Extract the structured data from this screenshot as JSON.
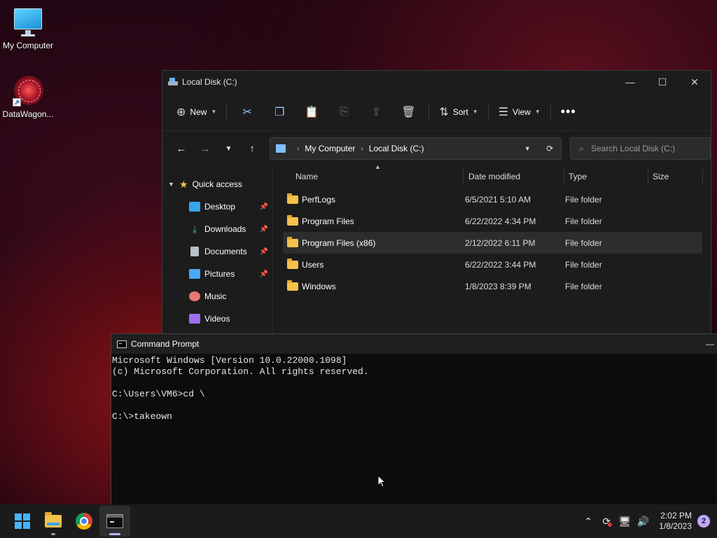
{
  "desktop": {
    "icons": [
      {
        "label": "My Computer",
        "icon": "monitor-icon"
      },
      {
        "label": "DataWagon...",
        "icon": "datawagon-icon"
      }
    ]
  },
  "explorer": {
    "title": "Local Disk (C:)",
    "toolbar": {
      "new_label": "New",
      "sort_label": "Sort",
      "view_label": "View",
      "icons": [
        "cut-icon",
        "copy-icon",
        "paste-icon",
        "rename-icon",
        "share-icon",
        "delete-icon",
        "more-icon"
      ]
    },
    "breadcrumb": [
      "My Computer",
      "Local Disk (C:)"
    ],
    "search_placeholder": "Search Local Disk (C:)",
    "nav": {
      "quick_access": "Quick access",
      "items": [
        {
          "label": "Desktop",
          "pinned": true,
          "icon": "desktop-icon",
          "color": "#3aa6f0"
        },
        {
          "label": "Downloads",
          "pinned": true,
          "icon": "download-icon",
          "color": "#3ec46d"
        },
        {
          "label": "Documents",
          "pinned": true,
          "icon": "documents-icon",
          "color": "#b7c0cc"
        },
        {
          "label": "Pictures",
          "pinned": true,
          "icon": "pictures-icon",
          "color": "#4aa8f5"
        },
        {
          "label": "Music",
          "pinned": false,
          "icon": "music-icon",
          "color": "#e8776f"
        },
        {
          "label": "Videos",
          "pinned": false,
          "icon": "videos-icon",
          "color": "#9b6ff0"
        }
      ]
    },
    "columns": {
      "name": "Name",
      "date": "Date modified",
      "type": "Type",
      "size": "Size"
    },
    "files": [
      {
        "name": "PerfLogs",
        "date": "6/5/2021 5:10 AM",
        "type": "File folder"
      },
      {
        "name": "Program Files",
        "date": "6/22/2022 4:34 PM",
        "type": "File folder"
      },
      {
        "name": "Program Files (x86)",
        "date": "2/12/2022 6:11 PM",
        "type": "File folder"
      },
      {
        "name": "Users",
        "date": "6/22/2022 3:44 PM",
        "type": "File folder"
      },
      {
        "name": "Windows",
        "date": "1/8/2023 8:39 PM",
        "type": "File folder"
      }
    ],
    "selected_file": "Program Files (x86)"
  },
  "cmd": {
    "title": "Command Prompt",
    "lines": [
      "Microsoft Windows [Version 10.0.22000.1098]",
      "(c) Microsoft Corporation. All rights reserved.",
      "",
      "C:\\Users\\VM6>cd \\",
      "",
      "C:\\>takeown"
    ]
  },
  "taskbar": {
    "apps": [
      "start-icon",
      "file-explorer-icon",
      "chrome-icon",
      "command-prompt-icon"
    ],
    "time": "2:02 PM",
    "date": "1/8/2023",
    "notification_count": "2"
  }
}
